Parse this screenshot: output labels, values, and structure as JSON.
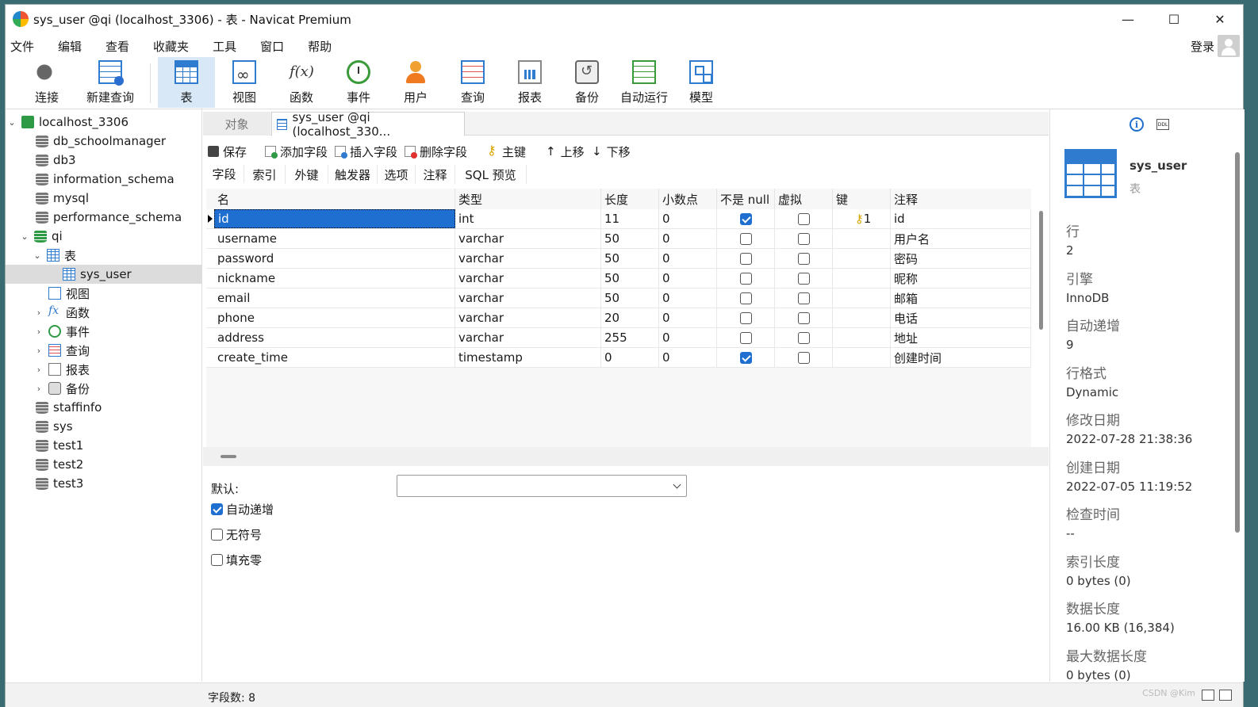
{
  "window": {
    "title": "sys_user @qi (localhost_3306) - 表 - Navicat Premium"
  },
  "menu": [
    "文件",
    "编辑",
    "查看",
    "收藏夹",
    "工具",
    "窗口",
    "帮助"
  ],
  "login_label": "登录",
  "toolbar": [
    "连接",
    "新建查询",
    "表",
    "视图",
    "函数",
    "事件",
    "用户",
    "查询",
    "报表",
    "备份",
    "自动运行",
    "模型"
  ],
  "tree": [
    {
      "label": "localhost_3306"
    },
    {
      "label": "db_schoolmanager"
    },
    {
      "label": "db3"
    },
    {
      "label": "information_schema"
    },
    {
      "label": "mysql"
    },
    {
      "label": "performance_schema"
    },
    {
      "label": "qi"
    },
    {
      "label": "表"
    },
    {
      "label": "sys_user"
    },
    {
      "label": "视图"
    },
    {
      "label": "函数"
    },
    {
      "label": "事件"
    },
    {
      "label": "查询"
    },
    {
      "label": "报表"
    },
    {
      "label": "备份"
    },
    {
      "label": "staffinfo"
    },
    {
      "label": "sys"
    },
    {
      "label": "test1"
    },
    {
      "label": "test2"
    },
    {
      "label": "test3"
    }
  ],
  "tabs": {
    "objects": "对象",
    "active": "sys_user @qi (localhost_330..."
  },
  "actions": [
    "保存",
    "添加字段",
    "插入字段",
    "删除字段",
    "主键",
    "上移",
    "下移"
  ],
  "subtabs": [
    "字段",
    "索引",
    "外键",
    "触发器",
    "选项",
    "注释",
    "SQL 预览"
  ],
  "grid": {
    "columns": [
      "名",
      "类型",
      "长度",
      "小数点",
      "不是 null",
      "虚拟",
      "键",
      "注释"
    ],
    "rows": [
      {
        "name": "id",
        "type": "int",
        "length": "11",
        "decimals": "0",
        "notnull": true,
        "virtual": false,
        "key": "1",
        "comment": "id"
      },
      {
        "name": "username",
        "type": "varchar",
        "length": "50",
        "decimals": "0",
        "notnull": false,
        "virtual": false,
        "key": "",
        "comment": "用户名"
      },
      {
        "name": "password",
        "type": "varchar",
        "length": "50",
        "decimals": "0",
        "notnull": false,
        "virtual": false,
        "key": "",
        "comment": "密码"
      },
      {
        "name": "nickname",
        "type": "varchar",
        "length": "50",
        "decimals": "0",
        "notnull": false,
        "virtual": false,
        "key": "",
        "comment": "昵称"
      },
      {
        "name": "email",
        "type": "varchar",
        "length": "50",
        "decimals": "0",
        "notnull": false,
        "virtual": false,
        "key": "",
        "comment": "邮箱"
      },
      {
        "name": "phone",
        "type": "varchar",
        "length": "20",
        "decimals": "0",
        "notnull": false,
        "virtual": false,
        "key": "",
        "comment": "电话"
      },
      {
        "name": "address",
        "type": "varchar",
        "length": "255",
        "decimals": "0",
        "notnull": false,
        "virtual": false,
        "key": "",
        "comment": "地址"
      },
      {
        "name": "create_time",
        "type": "timestamp",
        "length": "0",
        "decimals": "0",
        "notnull": true,
        "virtual": false,
        "key": "",
        "comment": "创建时间"
      }
    ]
  },
  "props": {
    "default_label": "默认:",
    "default_value": "",
    "auto_increment": {
      "label": "自动递增",
      "checked": true
    },
    "unsigned": {
      "label": "无符号",
      "checked": false
    },
    "zerofill": {
      "label": "填充零",
      "checked": false
    }
  },
  "info": {
    "name": "sys_user",
    "type": "表",
    "items": [
      {
        "k": "行",
        "v": "2"
      },
      {
        "k": "引擎",
        "v": "InnoDB"
      },
      {
        "k": "自动递增",
        "v": "9"
      },
      {
        "k": "行格式",
        "v": "Dynamic"
      },
      {
        "k": "修改日期",
        "v": "2022-07-28 21:38:36"
      },
      {
        "k": "创建日期",
        "v": "2022-07-05 11:19:52"
      },
      {
        "k": "检查时间",
        "v": "--"
      },
      {
        "k": "索引长度",
        "v": "0 bytes (0)"
      },
      {
        "k": "数据长度",
        "v": "16.00 KB (16,384)"
      },
      {
        "k": "最大数据长度",
        "v": "0 bytes (0)"
      }
    ]
  },
  "status": {
    "field_count": "字段数: 8",
    "watermark": "CSDN @Kim"
  },
  "colors": {
    "accent": "#1f6fd0",
    "selection": "#dcdcdc",
    "toolbar_active": "#d8e8f7"
  }
}
